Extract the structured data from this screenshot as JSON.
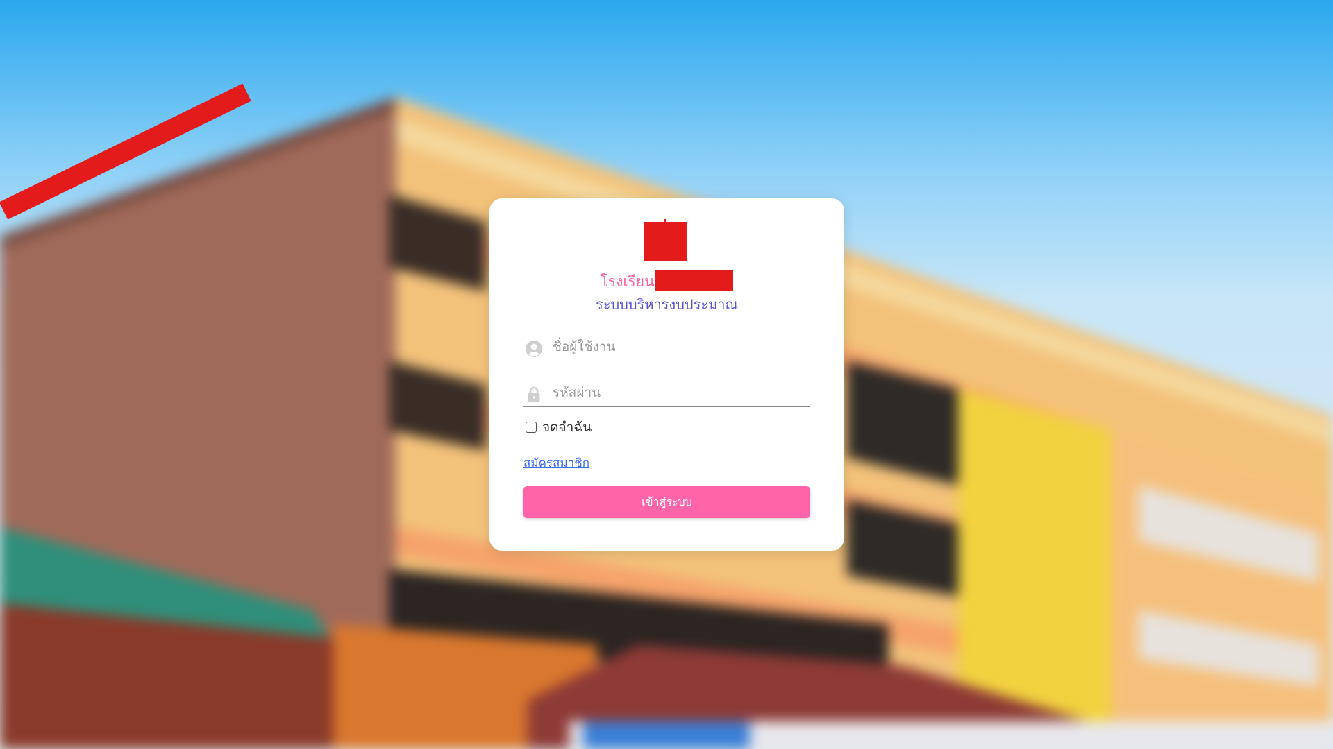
{
  "login": {
    "school_prefix": "โรงเรียน",
    "system_title": "ระบบบริหารงบประมาณ",
    "username_placeholder": "ชื่อผู้ใช้งาน",
    "password_placeholder": "รหัสผ่าน",
    "remember_label": "จดจำฉัน",
    "register_label": "สมัครสมาชิก",
    "submit_label": "เข้าสู่ระบบ"
  },
  "colors": {
    "accent_pink": "#ff64a8",
    "school_name_pink": "#ff5fa2",
    "title_purple": "#5a54d6",
    "link_blue": "#3a6ff0",
    "redaction_red": "#e41b1b"
  },
  "icons": {
    "username": "user-circle-icon",
    "password": "lock-icon"
  }
}
